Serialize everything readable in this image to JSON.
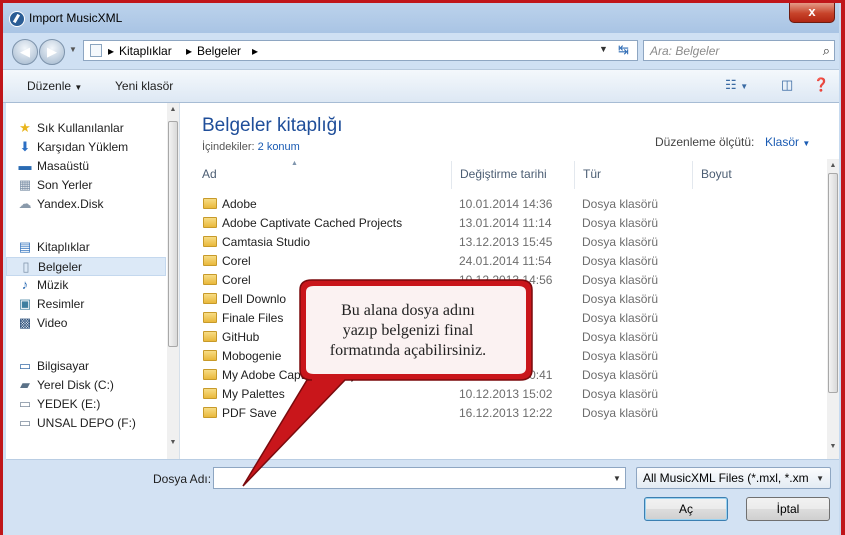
{
  "window": {
    "title": "Import MusicXML",
    "close_glyph": "x"
  },
  "address": {
    "crumbs": [
      "Kitaplıklar",
      "Belgeler"
    ],
    "search_placeholder": "Ara: Belgeler"
  },
  "toolbar": {
    "organize_label": "Düzenle",
    "new_folder_label": "Yeni klasör"
  },
  "sidebar": {
    "groups": [
      {
        "label": "Sık Kullanılanlar",
        "icon": "star-icon",
        "items": [
          {
            "label": "Karşıdan Yüklem",
            "icon": "downloads-icon"
          },
          {
            "label": "Masaüstü",
            "icon": "desktop-icon"
          },
          {
            "label": "Son Yerler",
            "icon": "recent-places-icon"
          },
          {
            "label": "Yandex.Disk",
            "icon": "cloud-drive-icon"
          }
        ]
      },
      {
        "label": "Kitaplıklar",
        "icon": "libraries-icon",
        "items": [
          {
            "label": "Belgeler",
            "icon": "documents-icon",
            "selected": true
          },
          {
            "label": "Müzik",
            "icon": "music-icon"
          },
          {
            "label": "Resimler",
            "icon": "pictures-icon"
          },
          {
            "label": "Video",
            "icon": "video-icon"
          }
        ]
      },
      {
        "label": "Bilgisayar",
        "icon": "computer-icon",
        "items": [
          {
            "label": "Yerel Disk (C:)",
            "icon": "local-disk-icon"
          },
          {
            "label": "YEDEK (E:)",
            "icon": "drive-icon"
          },
          {
            "label": "UNSAL DEPO (F:)",
            "icon": "drive-icon"
          }
        ]
      }
    ]
  },
  "library": {
    "title": "Belgeler kitaplığı",
    "contents_prefix": "İçindekiler:",
    "contents_link": "2 konum",
    "arrange_label": "Düzenleme ölçütü:",
    "arrange_value": "Klasör"
  },
  "columns": {
    "name": "Ad",
    "date": "Değiştirme tarihi",
    "type": "Tür",
    "size": "Boyut"
  },
  "files": [
    {
      "name": "Adobe",
      "date": "10.01.2014 14:36",
      "type": "Dosya klasörü"
    },
    {
      "name": "Adobe Captivate Cached Projects",
      "date": "13.01.2014 11:14",
      "type": "Dosya klasörü"
    },
    {
      "name": "Camtasia Studio",
      "date": "13.12.2013 15:45",
      "type": "Dosya klasörü"
    },
    {
      "name": "Corel",
      "date": "24.01.2014 11:54",
      "type": "Dosya klasörü"
    },
    {
      "name": "Corel",
      "date": "10.12.2013 14:56",
      "type": "Dosya klasörü"
    },
    {
      "name": "Dell Downlo",
      "date": "10:57",
      "type": "Dosya klasörü"
    },
    {
      "name": "Finale Files",
      "date": "7:58",
      "type": "Dosya klasörü"
    },
    {
      "name": "GitHub",
      "date": "2:53",
      "type": "Dosya klasörü"
    },
    {
      "name": "Mobogenie",
      "date": "2:05",
      "type": "Dosya klasörü"
    },
    {
      "name": "My Adobe Captivate Projects",
      "date": "09.01.2014 10:41",
      "type": "Dosya klasörü"
    },
    {
      "name": "My Palettes",
      "date": "10.12.2013 15:02",
      "type": "Dosya klasörü"
    },
    {
      "name": "PDF Save",
      "date": "16.12.2013 12:22",
      "type": "Dosya klasörü"
    }
  ],
  "bottom": {
    "filename_label": "Dosya Adı:",
    "filename_value": "",
    "filter_label": "All MusicXML Files (*.mxl, *.xm",
    "open_label": "Aç",
    "cancel_label": "İptal"
  },
  "callout": {
    "lines": [
      "Bu alana dosya adını",
      "yazıp belgenizi final",
      "formatında açabilirsiniz."
    ],
    "fill": "#c9161b",
    "inner": "#fbf2f2"
  }
}
